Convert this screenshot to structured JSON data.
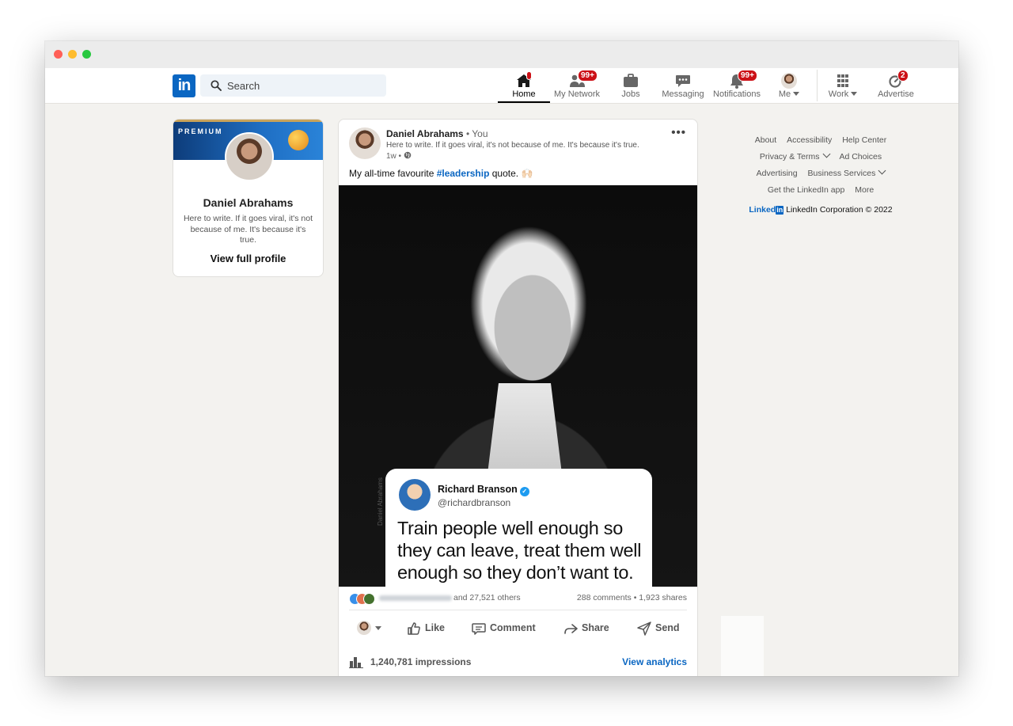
{
  "nav": {
    "search_placeholder": "Search",
    "items": [
      {
        "label": "Home",
        "icon": "home-icon",
        "badge": ""
      },
      {
        "label": "My Network",
        "icon": "network-icon",
        "badge": "99+"
      },
      {
        "label": "Jobs",
        "icon": "briefcase-icon",
        "badge": ""
      },
      {
        "label": "Messaging",
        "icon": "message-icon",
        "badge": ""
      },
      {
        "label": "Notifications",
        "icon": "bell-icon",
        "badge": "99+"
      },
      {
        "label": "Me",
        "icon": "avatar",
        "badge": ""
      },
      {
        "label": "Work",
        "icon": "grid-icon",
        "badge": ""
      },
      {
        "label": "Advertise",
        "icon": "advertise-icon",
        "badge": "2"
      }
    ],
    "active": "Home",
    "accent": "#0a66c2",
    "badge_color": "#cc1016"
  },
  "profile": {
    "banner_label": "PREMIUM",
    "name": "Daniel Abrahams",
    "headline": "Here to write. If it goes viral, it's not because of me. It's because it's true.",
    "link": "View full profile"
  },
  "post": {
    "author": "Daniel Abrahams",
    "relation": "• You",
    "headline": "Here to write. If it goes viral, it's not because of me. It's because it's true.",
    "time": "1w •",
    "text_before": "My all-time favourite ",
    "hashtag": "#leadership",
    "text_after": " quote. 🙌🏻",
    "image_watermark": "Daniel Abrahams",
    "tweet": {
      "name": "Richard Branson",
      "handle": "@richardbranson",
      "quote": "Train people well enough so they can leave, treat them well enough so they don’t want to."
    },
    "reactions_others": "and 27,521 others",
    "counts": "288 comments • 1,923 shares",
    "actions": {
      "like": "Like",
      "comment": "Comment",
      "share": "Share",
      "send": "Send"
    },
    "impressions": "1,240,781 impressions",
    "analytics": "View analytics"
  },
  "footer": {
    "links": [
      "About",
      "Accessibility",
      "Help Center",
      "Privacy & Terms",
      "Ad Choices",
      "Advertising",
      "Business Services",
      "Get the LinkedIn app",
      "More"
    ],
    "brand": "Linked",
    "brand_box": "in",
    "copyright": "LinkedIn Corporation © 2022"
  }
}
